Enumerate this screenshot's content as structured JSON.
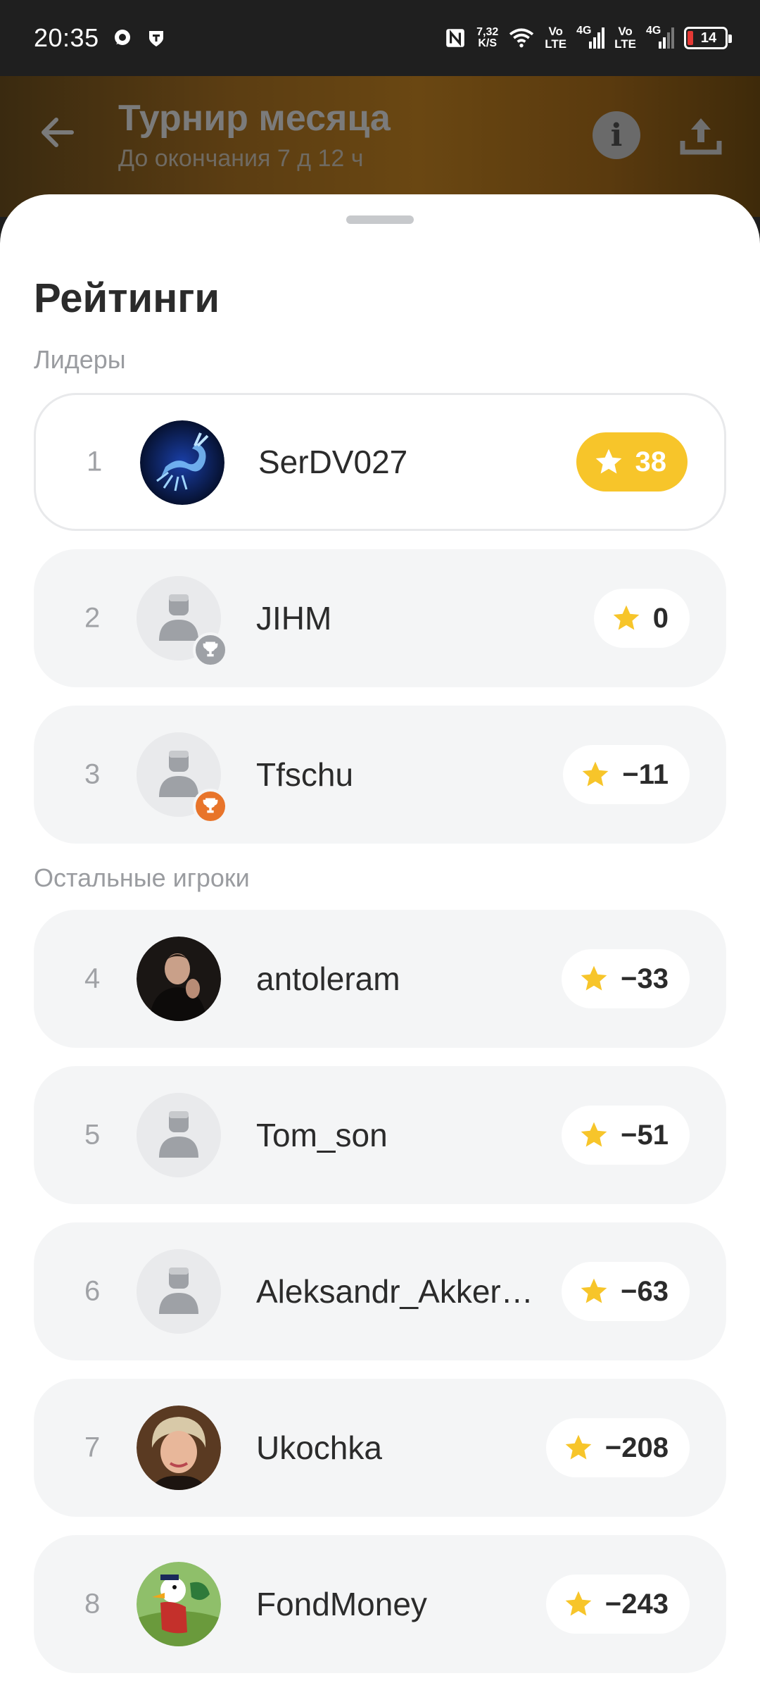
{
  "status_bar": {
    "time": "20:35",
    "speed_value": "7,32",
    "speed_unit": "K/S",
    "net1_top": "Vo",
    "net1_bottom": "LTE",
    "net1_gen": "4G",
    "net2_top": "Vo",
    "net2_bottom": "LTE",
    "net2_gen": "4G",
    "battery": "14"
  },
  "header": {
    "title": "Турнир месяца",
    "subtitle": "До окончания 7 д 12 ч",
    "info_glyph": "i"
  },
  "sheet": {
    "title": "Рейтинги",
    "leaders_label": "Лидеры",
    "others_label": "Остальные игроки"
  },
  "players": [
    {
      "rank": "1",
      "name": "SerDV027",
      "score": "38"
    },
    {
      "rank": "2",
      "name": "JIHM",
      "score": "0"
    },
    {
      "rank": "3",
      "name": "Tfschu",
      "score": "−11"
    },
    {
      "rank": "4",
      "name": "antoleram",
      "score": "−33"
    },
    {
      "rank": "5",
      "name": "Tom_son",
      "score": "−51"
    },
    {
      "rank": "6",
      "name": "Aleksandr_Akker…",
      "score": "−63"
    },
    {
      "rank": "7",
      "name": "Ukochka",
      "score": "−208"
    },
    {
      "rank": "8",
      "name": "FondMoney",
      "score": "−243"
    }
  ],
  "colors": {
    "gold": "#f7c52a",
    "silver_medal": "#9ea1a6",
    "bronze_medal": "#e8742a",
    "row_bg": "#f4f5f6"
  }
}
